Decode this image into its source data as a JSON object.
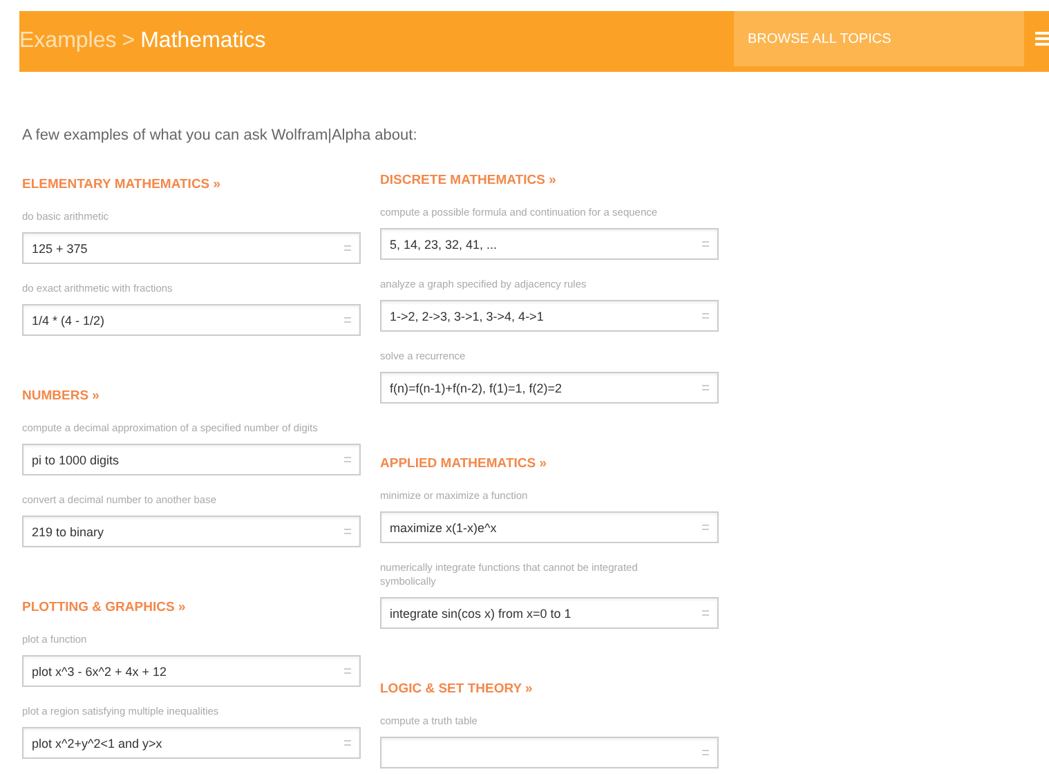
{
  "header": {
    "breadcrumb": {
      "parent": "Examples",
      "separator": ">",
      "current": "Mathematics"
    },
    "browse_button": "BROWSE ALL TOPICS"
  },
  "intro": "A few examples of what you can ask Wolfram|Alpha about:",
  "columns": [
    [
      {
        "title": "ELEMENTARY MATHEMATICS »",
        "examples": [
          {
            "description": "do basic arithmetic",
            "query": "125 + 375"
          },
          {
            "description": "do exact arithmetic with fractions",
            "query": "1/4 * (4 - 1/2)"
          }
        ]
      },
      {
        "title": "NUMBERS »",
        "examples": [
          {
            "description": "compute a decimal approximation of a specified number of digits",
            "query": "pi to 1000 digits"
          },
          {
            "description": "convert a decimal number to another base",
            "query": "219 to binary"
          }
        ]
      },
      {
        "title": "PLOTTING & GRAPHICS »",
        "examples": [
          {
            "description": "plot a function",
            "query": "plot x^3 - 6x^2 + 4x + 12"
          },
          {
            "description": "plot a region satisfying multiple inequalities",
            "query": "plot x^2+y^2<1 and y>x"
          }
        ]
      }
    ],
    [
      {
        "title": "DISCRETE MATHEMATICS »",
        "examples": [
          {
            "description": "compute a possible formula and continuation for a sequence",
            "query": "5, 14, 23, 32, 41, ..."
          },
          {
            "description": "analyze a graph specified by adjacency rules",
            "query": "1->2, 2->3, 3->1, 3->4, 4->1"
          },
          {
            "description": "solve a recurrence",
            "query": "f(n)=f(n-1)+f(n-2), f(1)=1, f(2)=2"
          }
        ]
      },
      {
        "title": "APPLIED MATHEMATICS »",
        "examples": [
          {
            "description": "minimize or maximize a function",
            "query": "maximize x(1-x)e^x"
          },
          {
            "description": "numerically integrate functions that cannot be integrated symbolically",
            "query": "integrate sin(cos x) from x=0 to 1"
          }
        ]
      },
      {
        "title": "LOGIC & SET THEORY »",
        "examples": [
          {
            "description": "compute a truth table"
          }
        ]
      }
    ]
  ]
}
